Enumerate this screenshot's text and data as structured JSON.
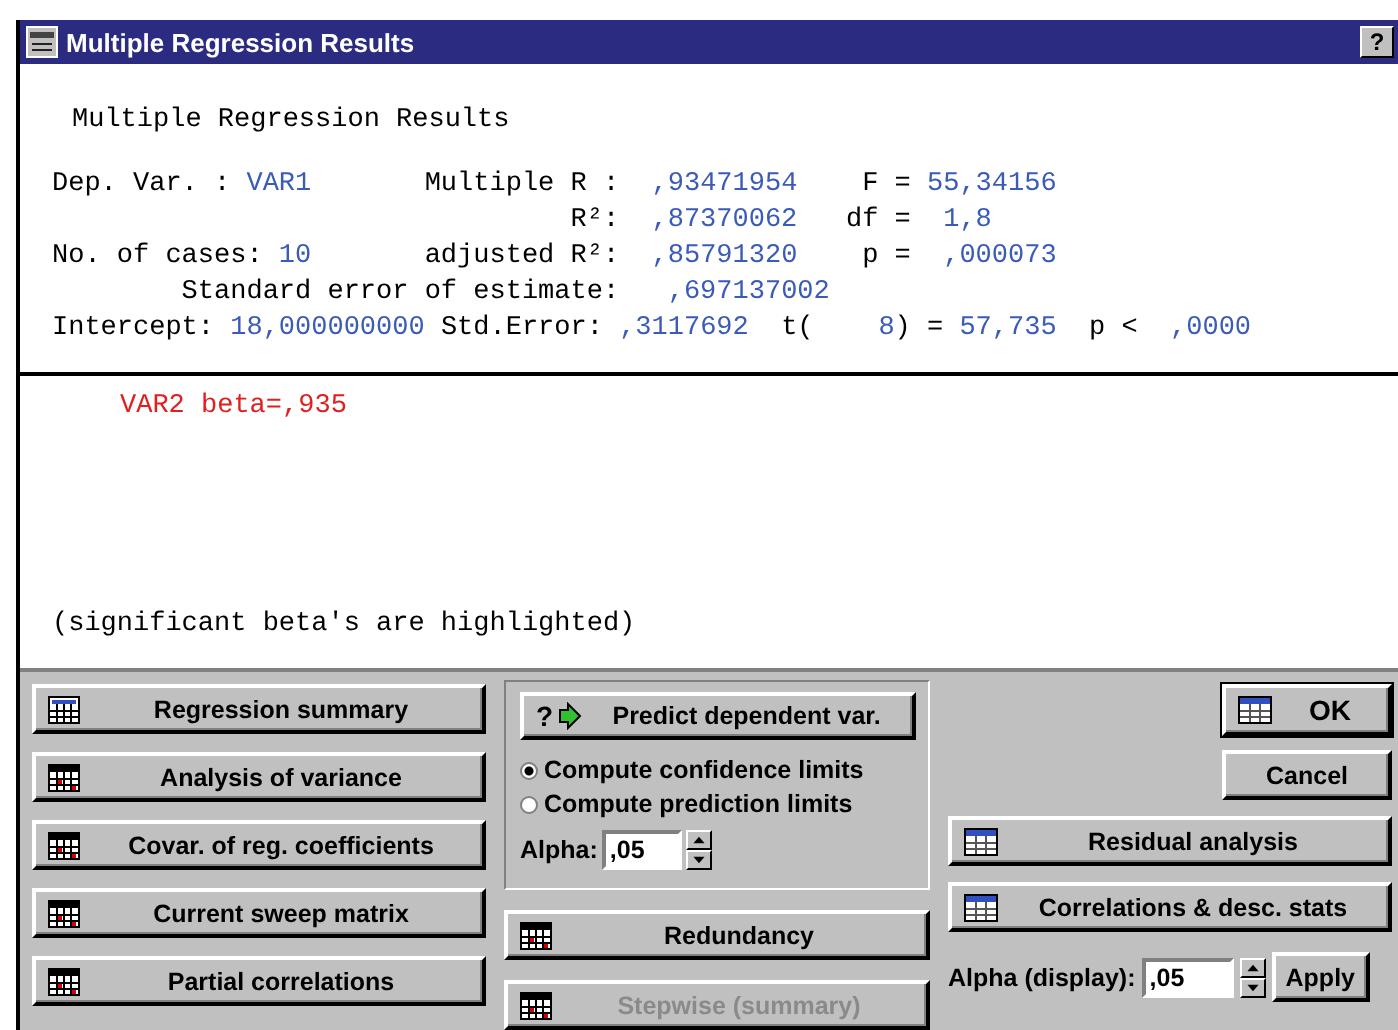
{
  "window": {
    "title": "Multiple Regression Results",
    "help": "?"
  },
  "results": {
    "heading": "Multiple Regression Results",
    "lines": [
      [
        {
          "kind": "label",
          "text": "Dep. Var. : "
        },
        {
          "kind": "value",
          "text": "VAR1"
        },
        {
          "kind": "label",
          "text": "       Multiple R :  "
        },
        {
          "kind": "value",
          "text": ",93471954"
        },
        {
          "kind": "label",
          "text": "    F = "
        },
        {
          "kind": "value",
          "text": "55,34156"
        }
      ],
      [
        {
          "kind": "label",
          "text": "                                R²:  "
        },
        {
          "kind": "value",
          "text": ",87370062"
        },
        {
          "kind": "label",
          "text": "   df =  "
        },
        {
          "kind": "value",
          "text": "1,8"
        }
      ],
      [
        {
          "kind": "label",
          "text": "No. of cases: "
        },
        {
          "kind": "value",
          "text": "10"
        },
        {
          "kind": "label",
          "text": "       adjusted R²:  "
        },
        {
          "kind": "value",
          "text": ",85791320"
        },
        {
          "kind": "label",
          "text": "    p =  "
        },
        {
          "kind": "value",
          "text": ",000073"
        }
      ],
      [
        {
          "kind": "label",
          "text": "        Standard error of estimate:   "
        },
        {
          "kind": "value",
          "text": ",697137002"
        }
      ],
      [
        {
          "kind": "label",
          "text": "Intercept: "
        },
        {
          "kind": "value",
          "text": "18,000000000"
        },
        {
          "kind": "label",
          "text": " Std.Error: "
        },
        {
          "kind": "value",
          "text": ",3117692"
        },
        {
          "kind": "label",
          "text": "  t(    "
        },
        {
          "kind": "value",
          "text": "8"
        },
        {
          "kind": "label",
          "text": ") = "
        },
        {
          "kind": "value",
          "text": "57,735"
        },
        {
          "kind": "label",
          "text": "  p <  "
        },
        {
          "kind": "value",
          "text": ",0000"
        }
      ]
    ]
  },
  "betas": [
    {
      "text": "VAR2 beta=,935",
      "significant": true
    }
  ],
  "note": "(significant beta's are highlighted)",
  "left_buttons": [
    {
      "label": "Regression summary",
      "disabled": false
    },
    {
      "label": "Analysis of variance",
      "disabled": false
    },
    {
      "label": "Covar. of reg. coefficients",
      "disabled": false
    },
    {
      "label": "Current sweep matrix",
      "disabled": false
    },
    {
      "label": "Partial correlations",
      "disabled": false
    }
  ],
  "predict": {
    "icon_mark": "?",
    "button": "Predict dependent var.",
    "options": [
      {
        "label": "Compute confidence limits",
        "selected": true
      },
      {
        "label": "Compute prediction limits",
        "selected": false
      }
    ],
    "alpha_label": "Alpha:",
    "alpha": ",05"
  },
  "middle_buttons": [
    {
      "label": "Redundancy",
      "disabled": false
    },
    {
      "label": "Stepwise (summary)",
      "disabled": true
    }
  ],
  "right_buttons": [
    {
      "label": "Residual analysis"
    },
    {
      "label": "Correlations & desc. stats"
    }
  ],
  "ok": {
    "label": "OK",
    "default": true
  },
  "cancel": {
    "label": "Cancel",
    "default": false
  },
  "alpha_display": {
    "label": "Alpha (display):",
    "value": ",05",
    "apply": "Apply"
  }
}
